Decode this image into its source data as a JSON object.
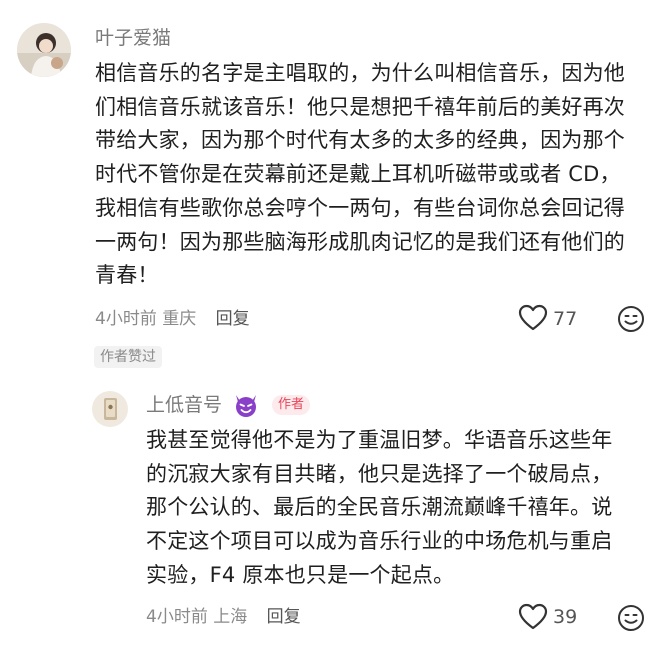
{
  "comment": {
    "username": "叶子爱猫",
    "lines": [
      "相信音乐的名字是主唱取的，为什么叫相信音乐，因为他",
      "们相信音乐就该音乐！他只是想把千禧年前后的美好再次",
      "带给大家，因为那个时代有太多的太多的经典，因为那个",
      "时代不管你是在荧幕前还是戴上耳机听磁带或或者 CD，",
      "我相信有些歌你总会哼个一两句，有些台词你总会回记得",
      "一两句！因为那些脑海形成肌肉记忆的是我们还有他们的",
      "青春！"
    ],
    "time": "4小时前",
    "location": "重庆",
    "reply_label": "回复",
    "likes": "77",
    "author_liked_badge": "作者赞过"
  },
  "reply": {
    "username": "上低音号",
    "author_tag": "作者",
    "lines": [
      "我甚至觉得他不是为了重温旧梦。华语音乐这些年",
      "的沉寂大家有目共睹，他只是选择了一个破局点，",
      "那个公认的、最后的全民音乐潮流巅峰千禧年。说",
      "不定这个项目可以成为音乐行业的中场危机与重启",
      "实验，F4 原本也只是一个起点。"
    ],
    "time": "4小时前",
    "location": "上海",
    "reply_label": "回复",
    "likes": "39"
  },
  "icons": {
    "heart": "heart-outline-icon",
    "emoji": "smiley-face-icon",
    "devil": "purple-devil-emoji"
  },
  "colors": {
    "username": "#7a7a7a",
    "text": "#1f1f1f",
    "meta": "#8a8a8a",
    "author_tag_bg": "#fdeaec",
    "author_tag_text": "#e8475b",
    "devil_emoji": "#8a3fc9"
  }
}
